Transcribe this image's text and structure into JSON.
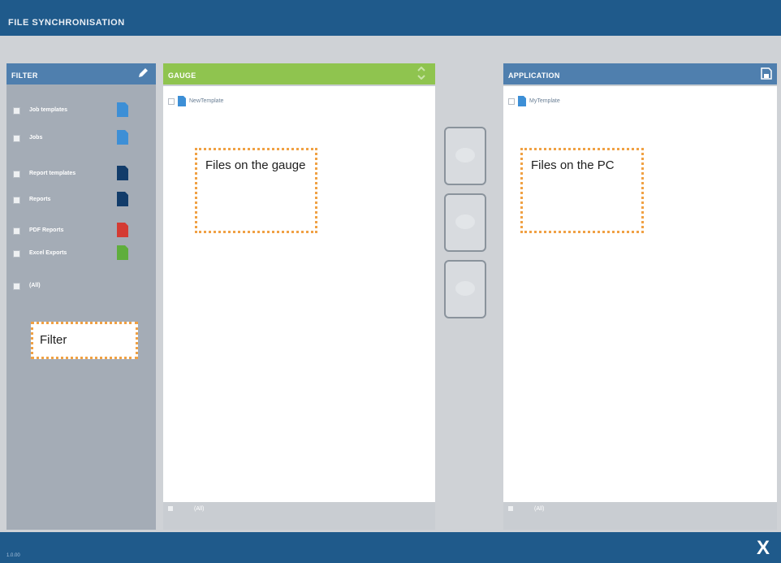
{
  "window": {
    "title": "FILE SYNCHRONISATION",
    "version": "1.0.00",
    "close_label": "X"
  },
  "filter": {
    "title": "FILTER",
    "items": [
      {
        "label": "Job templates",
        "icon": "file-icon-blue",
        "color": "#3d8fd6"
      },
      {
        "label": "Jobs",
        "icon": "file-icon-blue",
        "color": "#3d8fd6"
      },
      {
        "label": "Report templates",
        "icon": "file-icon-navy",
        "color": "#123c6a"
      },
      {
        "label": "Reports",
        "icon": "file-icon-navy",
        "color": "#123c6a"
      },
      {
        "label": "PDF Reports",
        "icon": "pdf-icon",
        "color": "#d43b33"
      },
      {
        "label": "Excel Exports",
        "icon": "excel-icon",
        "color": "#5fae3c"
      },
      {
        "label": "(All)"
      }
    ]
  },
  "gauge": {
    "title": "GAUGE",
    "files": [
      "NewTemplate"
    ],
    "all_label": "(All)"
  },
  "application": {
    "title": "APPLICATION",
    "files": [
      "MyTemplate"
    ],
    "all_label": "(All)"
  },
  "callouts": {
    "filter": "Filter",
    "gauge": "Files on the gauge",
    "pc": "Files on the PC"
  },
  "colors": {
    "header_blue": "#1f5a8b",
    "panel_blue": "#4f7fae",
    "gauge_green": "#8fc44f",
    "callout_orange": "#f0a144"
  }
}
